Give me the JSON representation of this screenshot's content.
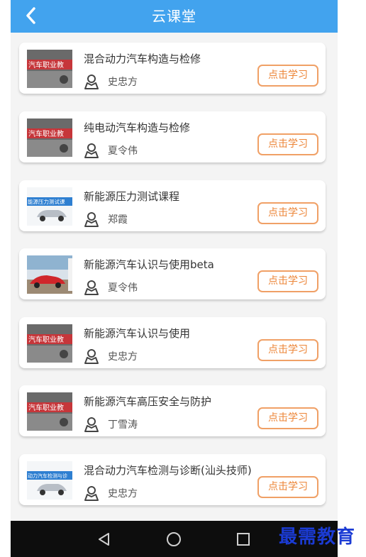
{
  "header": {
    "title": "云课堂",
    "back_icon": "chevron-left-icon"
  },
  "courses": [
    {
      "title": "混合动力汽车构造与检修",
      "teacher": "史忠方",
      "button": "点击学习",
      "thumb_text": "汽车职业教"
    },
    {
      "title": "纯电动汽车构造与检修",
      "teacher": "夏令伟",
      "button": "点击学习",
      "thumb_text": "汽车职业教"
    },
    {
      "title": "新能源压力测试课程",
      "teacher": "郑霞",
      "button": "点击学习",
      "thumb_text": "能源压力测试课"
    },
    {
      "title": "新能源汽车认识与使用beta",
      "teacher": "夏令伟",
      "button": "点击学习",
      "thumb_text": ""
    },
    {
      "title": "新能源汽车认识与使用",
      "teacher": "史忠方",
      "button": "点击学习",
      "thumb_text": "汽车职业教"
    },
    {
      "title": "新能源汽车高压安全与防护",
      "teacher": "丁雪涛",
      "button": "点击学习",
      "thumb_text": "汽车职业教"
    },
    {
      "title": "混合动力汽车检测与诊断(汕头技师)",
      "teacher": "史忠方",
      "button": "点击学习",
      "thumb_text": "动力汽车检测与诊"
    }
  ],
  "navbar": {
    "back": "back-triangle-icon",
    "home": "home-circle-icon",
    "recent": "recent-square-icon"
  },
  "watermark": "最需教育",
  "colors": {
    "header": "#42a3ee",
    "button_border": "#f0a066",
    "button_text": "#ec8436",
    "navbar": "#0d0d0d"
  }
}
